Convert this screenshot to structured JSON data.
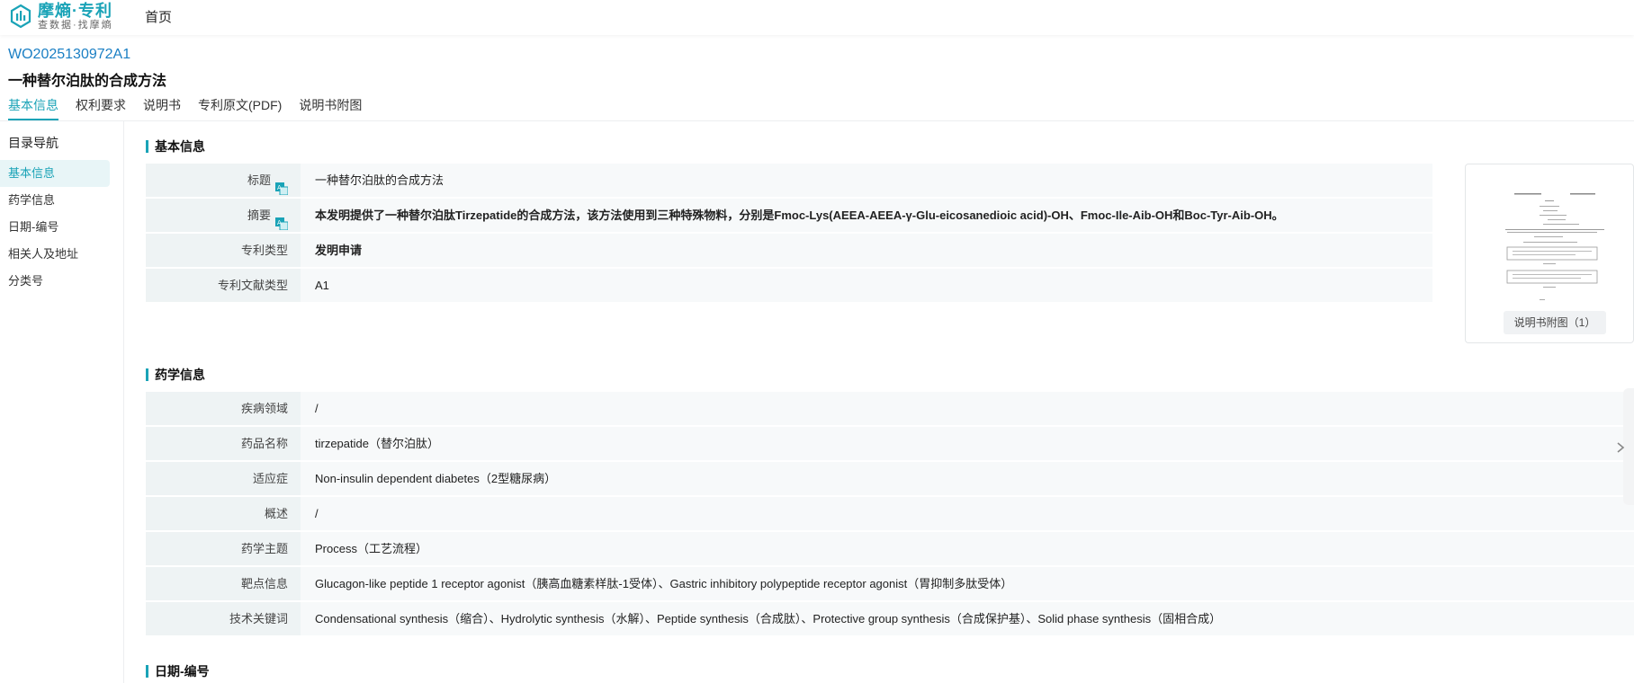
{
  "header": {
    "logo_name": "摩熵·专利",
    "logo_slogan": "查数据·找摩熵",
    "home_label": "首页"
  },
  "patent": {
    "number": "WO2025130972A1",
    "title": "一种替尔泊肽的合成方法"
  },
  "tabs": [
    {
      "label": "基本信息",
      "active": true
    },
    {
      "label": "权利要求",
      "active": false
    },
    {
      "label": "说明书",
      "active": false
    },
    {
      "label": "专利原文(PDF)",
      "active": false
    },
    {
      "label": "说明书附图",
      "active": false
    }
  ],
  "sidebar": {
    "title": "目录导航",
    "items": [
      {
        "label": "基本信息",
        "active": true
      },
      {
        "label": "药学信息",
        "active": false
      },
      {
        "label": "日期-编号",
        "active": false
      },
      {
        "label": "相关人及地址",
        "active": false
      },
      {
        "label": "分类号",
        "active": false
      }
    ]
  },
  "basic": {
    "section_title": "基本信息",
    "rows": [
      {
        "label": "标题",
        "value": "一种替尔泊肽的合成方法"
      },
      {
        "label": "摘要",
        "value": "本发明提供了一种替尔泊肽Tirzepatide的合成方法，该方法使用到三种特殊物料，分别是Fmoc-Lys(AEEA-AEEA-γ-Glu-eicosanedioic acid)-OH、Fmoc-Ile-Aib-OH和Boc-Tyr-Aib-OH。"
      },
      {
        "label": "专利类型",
        "value": "发明申请"
      },
      {
        "label": "专利文献类型",
        "value": "A1"
      }
    ]
  },
  "figure": {
    "button_label": "说明书附图（1）"
  },
  "pharma": {
    "section_title": "药学信息",
    "rows": [
      {
        "label": "疾病领域",
        "value": "/"
      },
      {
        "label": "药品名称",
        "value": "tirzepatide（替尔泊肽）"
      },
      {
        "label": "适应症",
        "value": "Non-insulin dependent diabetes（2型糖尿病）"
      },
      {
        "label": "概述",
        "value": "/"
      },
      {
        "label": "药学主题",
        "value": "Process（工艺流程）"
      },
      {
        "label": "靶点信息",
        "value": "Glucagon-like peptide 1 receptor agonist（胰高血糖素样肽-1受体）、Gastric inhibitory polypeptide receptor agonist（胃抑制多肽受体）"
      },
      {
        "label": "技术关键词",
        "value": "Condensational synthesis（缩合）、Hydrolytic synthesis（水解）、Peptide synthesis（合成肽）、Protective group synthesis（合成保护基）、Solid phase synthesis（固相合成）"
      }
    ]
  },
  "dates": {
    "section_title": "日期-编号"
  },
  "colors": {
    "accent": "#1aa3b7",
    "link": "#1a7fc4"
  }
}
